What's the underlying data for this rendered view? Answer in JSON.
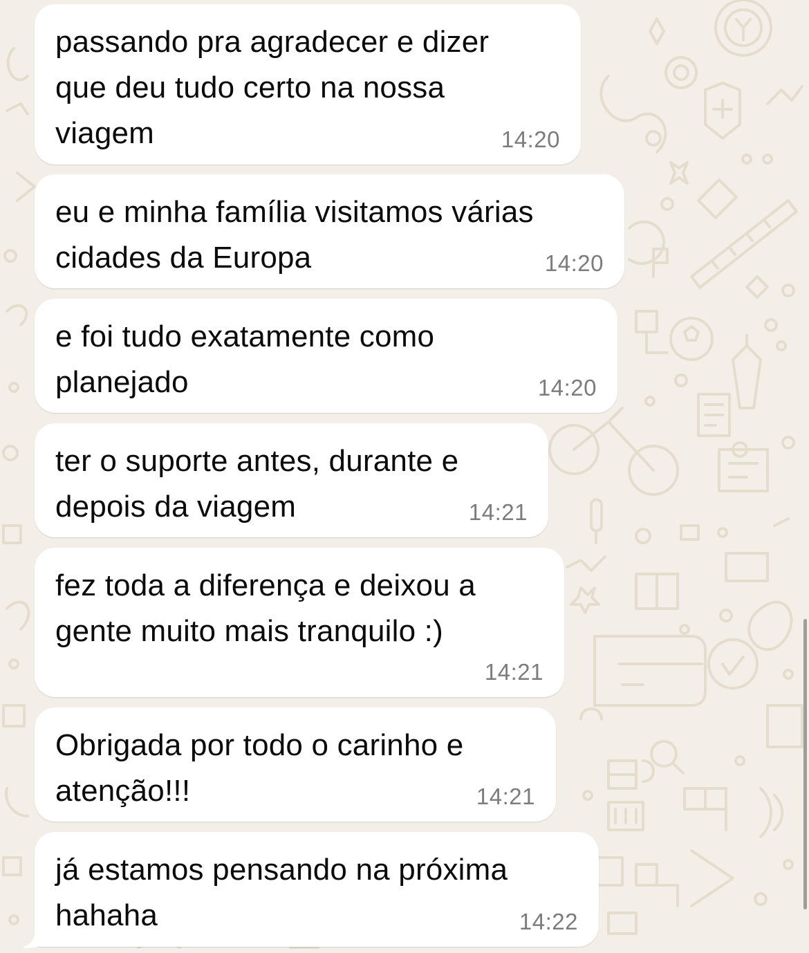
{
  "chat": {
    "messages": [
      {
        "text": "passando pra agradecer e dizer\nque deu tudo certo na nossa\nviagem",
        "time": "14:20"
      },
      {
        "text": "eu e minha família visitamos várias\ncidades da Europa",
        "time": "14:20"
      },
      {
        "text": "e foi tudo exatamente como\nplanejado",
        "time": "14:20"
      },
      {
        "text": "ter o suporte antes, durante e\ndepois da viagem",
        "time": "14:21"
      },
      {
        "text": "fez toda a diferença e deixou a\ngente muito mais tranquilo :)",
        "time": "14:21"
      },
      {
        "text": "Obrigada por todo o carinho e\natenção!!!",
        "time": "14:21"
      },
      {
        "text": "já estamos pensando na próxima\nhahaha",
        "time": "14:22"
      }
    ]
  },
  "colors": {
    "wallpaper": "#f3efe8",
    "bubble": "#ffffff",
    "text": "#0b0b0b",
    "timestamp": "#7c7c7c"
  }
}
